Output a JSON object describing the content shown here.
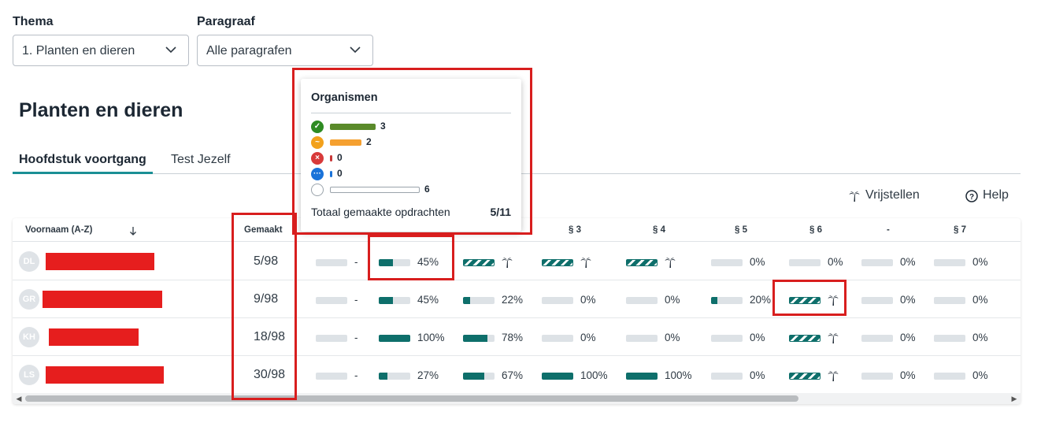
{
  "filters": {
    "theme_label": "Thema",
    "theme_value": "1. Planten en dieren",
    "paragraph_label": "Paragraaf",
    "paragraph_value": "Alle paragrafen"
  },
  "page_title": "Planten en dieren",
  "tabs": [
    {
      "label": "Hoofdstuk voortgang",
      "active": true
    },
    {
      "label": "Test Jezelf",
      "active": false
    }
  ],
  "toolbar": {
    "exempt_label": "Vrijstellen",
    "help_label": "Help"
  },
  "table": {
    "name_header": "Voornaam (A-Z)",
    "made_header": "Gemaakt",
    "section_headers": [
      "§ 3",
      "§ 4",
      "§ 5",
      "§ 6",
      "-",
      "§ 7"
    ],
    "rows": [
      {
        "initials": "DL",
        "made": "5/98",
        "cells": [
          {
            "kind": "text",
            "fill": 0,
            "text": "-"
          },
          {
            "kind": "bar",
            "fill": 0.45,
            "text": "45%"
          },
          {
            "kind": "hatch",
            "fill": 1,
            "text": ""
          },
          {
            "kind": "hatch",
            "fill": 1,
            "text": ""
          },
          {
            "kind": "hatch",
            "fill": 1,
            "text": ""
          },
          {
            "kind": "bar",
            "fill": 0,
            "text": "0%"
          },
          {
            "kind": "bar",
            "fill": 0,
            "text": "0%"
          },
          {
            "kind": "bar",
            "fill": 0,
            "text": "0%"
          },
          {
            "kind": "bar",
            "fill": 0,
            "text": "0%"
          }
        ]
      },
      {
        "initials": "GR",
        "made": "9/98",
        "cells": [
          {
            "kind": "text",
            "fill": 0,
            "text": "-"
          },
          {
            "kind": "bar",
            "fill": 0.45,
            "text": "45%"
          },
          {
            "kind": "bar",
            "fill": 0.22,
            "text": "22%"
          },
          {
            "kind": "bar",
            "fill": 0,
            "text": "0%"
          },
          {
            "kind": "bar",
            "fill": 0,
            "text": "0%"
          },
          {
            "kind": "bar",
            "fill": 0.2,
            "text": "20%"
          },
          {
            "kind": "hatch",
            "fill": 1,
            "text": ""
          },
          {
            "kind": "bar",
            "fill": 0,
            "text": "0%"
          },
          {
            "kind": "bar",
            "fill": 0,
            "text": "0%"
          }
        ]
      },
      {
        "initials": "KH",
        "made": "18/98",
        "cells": [
          {
            "kind": "text",
            "fill": 0,
            "text": "-"
          },
          {
            "kind": "bar",
            "fill": 1,
            "text": "100%"
          },
          {
            "kind": "bar",
            "fill": 0.78,
            "text": "78%"
          },
          {
            "kind": "bar",
            "fill": 0,
            "text": "0%"
          },
          {
            "kind": "bar",
            "fill": 0,
            "text": "0%"
          },
          {
            "kind": "bar",
            "fill": 0,
            "text": "0%"
          },
          {
            "kind": "hatch",
            "fill": 1,
            "text": ""
          },
          {
            "kind": "bar",
            "fill": 0,
            "text": "0%"
          },
          {
            "kind": "bar",
            "fill": 0,
            "text": "0%"
          }
        ]
      },
      {
        "initials": "LS",
        "made": "30/98",
        "cells": [
          {
            "kind": "text",
            "fill": 0,
            "text": "-"
          },
          {
            "kind": "bar",
            "fill": 0.27,
            "text": "27%"
          },
          {
            "kind": "bar",
            "fill": 0.67,
            "text": "67%"
          },
          {
            "kind": "bar",
            "fill": 1,
            "text": "100%"
          },
          {
            "kind": "bar",
            "fill": 1,
            "text": "100%"
          },
          {
            "kind": "bar",
            "fill": 0,
            "text": "0%"
          },
          {
            "kind": "hatch",
            "fill": 1,
            "text": ""
          },
          {
            "kind": "bar",
            "fill": 0,
            "text": "0%"
          },
          {
            "kind": "bar",
            "fill": 0,
            "text": "0%"
          }
        ]
      }
    ]
  },
  "popup": {
    "title": "Organismen",
    "legend": [
      {
        "icon": "check-icon",
        "color": "#2e8b22",
        "bar_color": "#5a8a2a",
        "count": "3"
      },
      {
        "icon": "tilde-icon",
        "color": "#f2a11c",
        "bar_color": "#f5a030",
        "count": "2"
      },
      {
        "icon": "cross-icon",
        "color": "#d83a3a",
        "bar_color": "#c83838",
        "count": "0"
      },
      {
        "icon": "ellipsis-icon",
        "color": "#1a73d9",
        "bar_color": "#1a73d9",
        "count": "0"
      },
      {
        "icon": "empty-circle-icon",
        "color": "#ffffff",
        "bar_color": "#ffffff",
        "count": "6"
      }
    ],
    "total_label": "Totaal gemaakte opdrachten",
    "total_value": "5/11"
  },
  "colors": {
    "accent": "#1b8f95",
    "progress": "#0e6f6b",
    "highlight": "#d81e1e"
  }
}
